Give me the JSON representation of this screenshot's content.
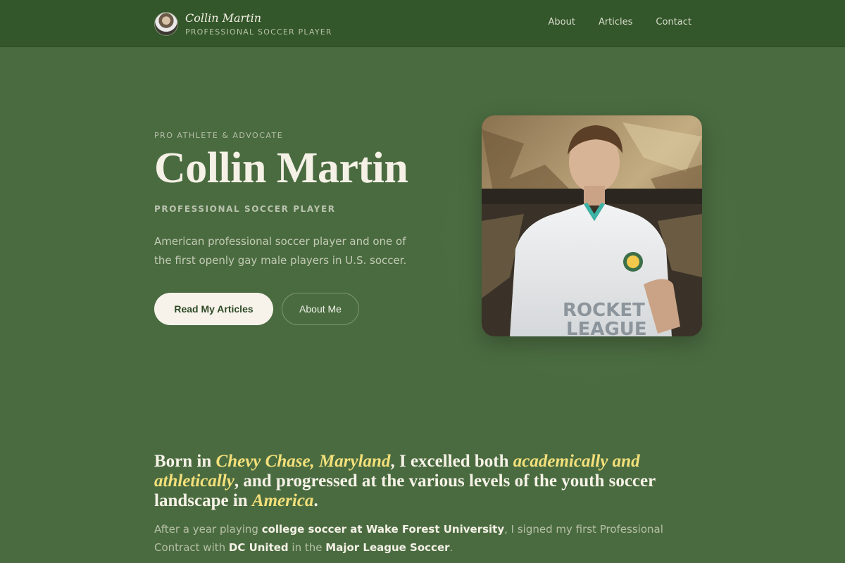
{
  "header": {
    "brand_name": "Collin Martin",
    "brand_subtitle": "PROFESSIONAL SOCCER PLAYER",
    "avatar": "avatar-photo",
    "nav": [
      "About",
      "Articles",
      "Contact"
    ]
  },
  "hero": {
    "eyebrow": "PRO ATHLETE & ADVOCATE",
    "title": "Collin Martin",
    "subtitle": "PROFESSIONAL SOCCER PLAYER",
    "description": "American professional soccer player and one of the first openly gay male players in U.S. soccer.",
    "primary_button": "Read My Articles",
    "secondary_button": "About Me",
    "photo": "portrait-photo"
  },
  "bio": {
    "lead": {
      "t1": "Born in ",
      "h1": "Chevy Chase, Maryland",
      "t2": ", I excelled both ",
      "h2": "academically and athletically",
      "t3": ", and progressed at the various levels of the youth soccer landscape in ",
      "h3": "America",
      "t4": "."
    },
    "body": {
      "t1": "After a year playing ",
      "s1": "college soccer at Wake Forest University",
      "t2": ", I signed my first Professional Contract with ",
      "s2": "DC United",
      "t3": " in the ",
      "s3": "Major League Soccer",
      "t4": "."
    }
  },
  "colors": {
    "background": "#4a6b40",
    "header": "#33562a",
    "highlight": "#f4e07a",
    "text": "#f3efe4"
  }
}
